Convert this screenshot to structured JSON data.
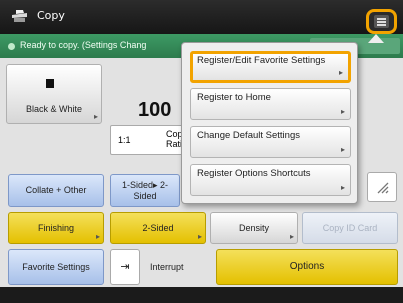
{
  "title": "Copy",
  "status": {
    "text": "Ready to copy. (Settings Chang"
  },
  "main": {
    "color_mode": "Black & White",
    "copies": "100",
    "ratio": {
      "value": "1:1",
      "label": "Copy Ratio"
    },
    "sided_info": "1-Sided▸ 2-Sided",
    "buttons": {
      "collate": "Collate + Other",
      "finishing": "Finishing",
      "two_sided": "2-Sided",
      "density": "Density",
      "copy_id_card": "Copy ID Card",
      "favorite_settings": "Favorite Settings",
      "interrupt": "Interrupt",
      "options": "Options"
    }
  },
  "menu": {
    "items": [
      {
        "label": "Register/Edit Favorite Settings",
        "selected": true
      },
      {
        "label": "Register to Home",
        "selected": false
      },
      {
        "label": "Change Default Settings",
        "selected": false
      },
      {
        "label": "Register Options Shortcuts",
        "selected": false
      }
    ]
  },
  "colors": {
    "accent": "#f2a300",
    "status_bar": "#3a9060",
    "yellow_button": "#e8c800",
    "blue_button": "#b9cdef"
  }
}
